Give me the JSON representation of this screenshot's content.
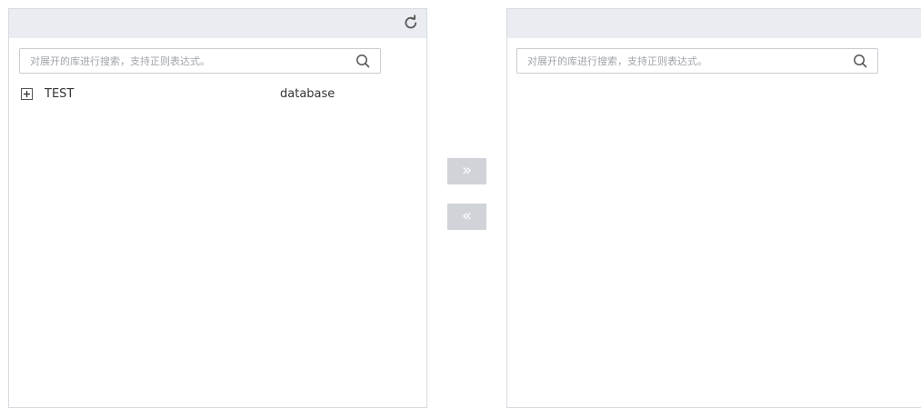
{
  "left_panel": {
    "search": {
      "placeholder": "对展开的库进行搜索，支持正则表达式。",
      "value": ""
    },
    "tree": [
      {
        "name": "TEST",
        "type": "database",
        "expanded": false
      }
    ]
  },
  "right_panel": {
    "search": {
      "placeholder": "对展开的库进行搜索，支持正则表达式。",
      "value": ""
    },
    "tree": []
  },
  "transfer": {
    "move_right_label": "»",
    "move_left_label": "«",
    "button_color": "#d0d3d8"
  },
  "icons": {
    "refresh": "refresh-icon",
    "search": "search-icon",
    "expand": "plus-box-icon"
  },
  "colors": {
    "header_bg": "#e9ecf0",
    "border": "#d7dbe0"
  }
}
